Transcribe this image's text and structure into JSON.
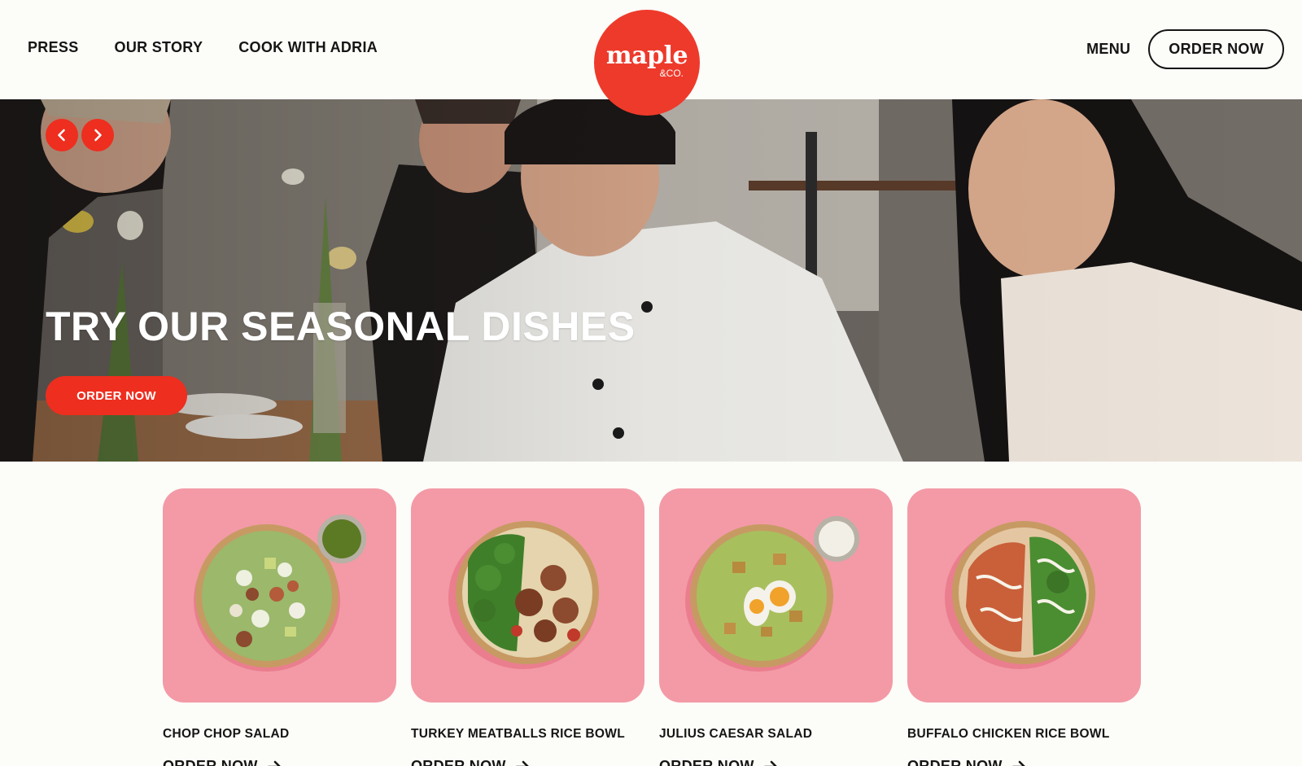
{
  "nav": {
    "left": [
      {
        "label": "PRESS"
      },
      {
        "label": "OUR STORY"
      },
      {
        "label": "COOK WITH ADRIA"
      }
    ],
    "menu_label": "MENU",
    "order_label": "ORDER NOW"
  },
  "logo": {
    "word": "maple",
    "sub": "&CO."
  },
  "hero": {
    "title": "TRY OUR SEASONAL DISHES",
    "cta_label": "ORDER NOW",
    "prev_icon": "chevron-left-icon",
    "next_icon": "chevron-right-icon"
  },
  "products": [
    {
      "title": "CHOP CHOP SALAD",
      "order_label": "ORDER NOW"
    },
    {
      "title": "TURKEY MEATBALLS RICE BOWL",
      "order_label": "ORDER NOW"
    },
    {
      "title": "JULIUS CAESAR SALAD",
      "order_label": "ORDER NOW"
    },
    {
      "title": "BUFFALO CHICKEN RICE BOWL",
      "order_label": "ORDER NOW"
    }
  ],
  "colors": {
    "brand_red": "#ee3a2b",
    "card_pink": "#f39aa6",
    "background": "#fcfcf8",
    "text": "#151515"
  }
}
